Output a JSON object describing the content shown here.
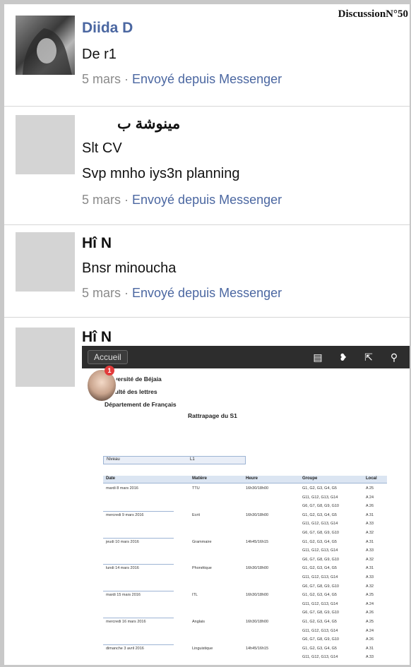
{
  "corner_label": "DiscussionN°50",
  "messages": [
    {
      "name": "Diida D",
      "lines": [
        "De r1"
      ],
      "date": "5 mars",
      "via": "Envoyé depuis Messenger"
    },
    {
      "name": "مينوشة ب",
      "lines": [
        "Slt CV",
        "Svp mnho iys3n planning"
      ],
      "date": "5 mars",
      "via": "Envoyé depuis Messenger"
    },
    {
      "name": "Hî N",
      "lines": [
        "Bnsr minoucha"
      ],
      "date": "5 mars",
      "via": "Envoyé depuis Messenger"
    },
    {
      "name": "Hî N"
    }
  ],
  "separator": " · ",
  "screenshot": {
    "home_label": "Accueil",
    "badge": "1",
    "icons": [
      "list-icon",
      "chat-icon",
      "share-icon",
      "search-icon"
    ],
    "doc": {
      "univ": "Université de Béjaia",
      "faculty": "Faculté des lettres",
      "dept": "Département de Français",
      "title": "Rattrapage du S1",
      "niveau_label": "Niveau",
      "niveau_value": "L1",
      "headers": [
        "Date",
        "Matière",
        "Heure",
        "Groupe",
        "Local"
      ],
      "rows": [
        [
          "mardi 8 mars 2016",
          "TTU",
          "16h30/18h00",
          "G1, G2, G3, G4, G5",
          "A 25"
        ],
        [
          "",
          "",
          "",
          "G11, G12, G13, G14",
          "A 24"
        ],
        [
          "",
          "",
          "",
          "G6, G7, G8, G9, G10",
          "A 26"
        ],
        [
          "mercredi 9 mars 2016",
          "Ecrit",
          "16h30/18h00",
          "G1, G2, G3, G4, G5",
          "A 31"
        ],
        [
          "",
          "",
          "",
          "G11, G12, G13, G14",
          "A 33"
        ],
        [
          "",
          "",
          "",
          "G6, G7, G8, G9, G10",
          "A 32"
        ],
        [
          "jeudi 10 mars 2016",
          "Grammaire",
          "14h45/16h15",
          "G1, G2, G3, G4, G5",
          "A 31"
        ],
        [
          "",
          "",
          "",
          "G11, G12, G13, G14",
          "A 33"
        ],
        [
          "",
          "",
          "",
          "G6, G7, G8, G9, G10",
          "A 32"
        ],
        [
          "lundi 14 mars 2016",
          "Phonétique",
          "16h30/18h00",
          "G1, G2, G3, G4, G5",
          "A 31"
        ],
        [
          "",
          "",
          "",
          "G11, G12, G13, G14",
          "A 33"
        ],
        [
          "",
          "",
          "",
          "G6, G7, G8, G9, G10",
          "A 32"
        ],
        [
          "mardi 15 mars 2016",
          "ITL",
          "16h30/18h00",
          "G1, G2, G3, G4, G5",
          "A 25"
        ],
        [
          "",
          "",
          "",
          "G11, G12, G13, G14",
          "A 24"
        ],
        [
          "",
          "",
          "",
          "G6, G7, G8, G9, G10",
          "A 26"
        ],
        [
          "mercredi 16 mars 2016",
          "Anglais",
          "16h30/18h00",
          "G1, G2, G3, G4, G5",
          "A 25"
        ],
        [
          "",
          "",
          "",
          "G11, G12, G13, G14",
          "A 24"
        ],
        [
          "",
          "",
          "",
          "G6, G7, G8, G9, G10",
          "A 26"
        ],
        [
          "dimanche 3 avril 2016",
          "Linguistique",
          "14h45/16h15",
          "G1, G2, G3, G4, G5",
          "A 31"
        ],
        [
          "",
          "",
          "",
          "G11, G12, G13, G14",
          "A 33"
        ]
      ]
    }
  }
}
